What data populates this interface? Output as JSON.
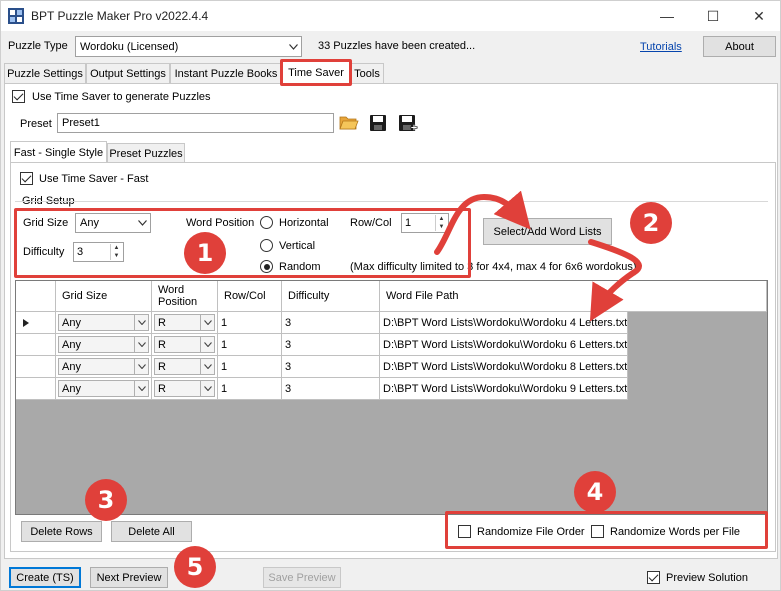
{
  "window": {
    "title": "BPT Puzzle Maker Pro v2022.4.4",
    "controls": {
      "minimize": "—",
      "maximize": "☐",
      "close": "✕"
    }
  },
  "header": {
    "puzzle_type_label": "Puzzle Type",
    "puzzle_type_value": "Wordoku (Licensed)",
    "status": "33 Puzzles have been created...",
    "tutorials": "Tutorials",
    "about": "About"
  },
  "main_tabs": [
    {
      "label": "Puzzle Settings"
    },
    {
      "label": "Output Settings"
    },
    {
      "label": "Instant Puzzle Books"
    },
    {
      "label": "Time Saver"
    },
    {
      "label": "Tools"
    }
  ],
  "time_saver": {
    "use_checkbox_label": "Use Time Saver to generate Puzzles",
    "use_checked": true,
    "preset_label": "Preset",
    "preset_value": "Preset1"
  },
  "sub_tabs": [
    {
      "label": "Fast - Single Style"
    },
    {
      "label": "Preset Puzzles"
    }
  ],
  "fast": {
    "use_fast_label": "Use Time Saver - Fast",
    "use_fast_checked": true,
    "grid_setup_label": "Grid Setup",
    "grid_size_label": "Grid Size",
    "grid_size_value": "Any",
    "difficulty_label": "Difficulty",
    "difficulty_value": "3",
    "word_position_label": "Word Position",
    "pos_horizontal": "Horizontal",
    "pos_vertical": "Vertical",
    "pos_random": "Random",
    "selected_position": "Random",
    "row_col_label": "Row/Col",
    "row_col_value": "1",
    "note": "(Max difficulty limited to 3 for 4x4, max 4 for 6x6 wordokus)",
    "select_word_lists": "Select/Add Word Lists"
  },
  "table": {
    "columns": [
      "Grid Size",
      "Word\nPosition",
      "Row/Col",
      "Difficulty",
      "Word File Path"
    ],
    "rows": [
      {
        "grid_size": "Any",
        "position": "R",
        "row_col": "1",
        "difficulty": "3",
        "path": "D:\\BPT Word Lists\\Wordoku\\Wordoku 4 Letters.txt"
      },
      {
        "grid_size": "Any",
        "position": "R",
        "row_col": "1",
        "difficulty": "3",
        "path": "D:\\BPT Word Lists\\Wordoku\\Wordoku 6 Letters.txt"
      },
      {
        "grid_size": "Any",
        "position": "R",
        "row_col": "1",
        "difficulty": "3",
        "path": "D:\\BPT Word Lists\\Wordoku\\Wordoku 8 Letters.txt"
      },
      {
        "grid_size": "Any",
        "position": "R",
        "row_col": "1",
        "difficulty": "3",
        "path": "D:\\BPT Word Lists\\Wordoku\\Wordoku 9 Letters.txt"
      }
    ]
  },
  "actions": {
    "delete_rows": "Delete Rows",
    "delete_all": "Delete All",
    "randomize_file_order": "Randomize File Order",
    "randomize_words_per_file": "Randomize Words per File",
    "create": "Create (TS)",
    "next_preview": "Next Preview",
    "save_preview": "Save Preview",
    "preview_solution": "Preview Solution",
    "preview_solution_checked": true
  },
  "annotations": {
    "badge_1": "1",
    "badge_2": "2",
    "badge_3": "3",
    "badge_4": "4",
    "badge_5": "5",
    "highlight_color": "#e0403a"
  }
}
